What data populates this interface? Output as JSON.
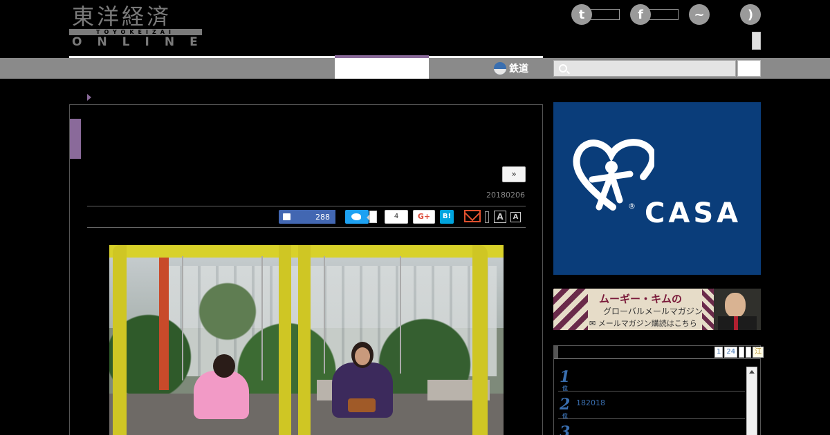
{
  "header": {
    "logo_kanji": "東洋経済",
    "logo_romaji": "TOYOKEIZAI",
    "logo_online": "ONLINE"
  },
  "nav": {
    "rail_label": "鉄道",
    "search_placeholder": ""
  },
  "article": {
    "next_label": "»",
    "date": "20180206",
    "share": {
      "facebook_count": "288",
      "hatena_count": "4",
      "gplus_label": "G+",
      "hatena_label": "B!",
      "font_large": "A",
      "font_small": "A"
    }
  },
  "sidebar": {
    "ad_casa": {
      "brand": "CASA",
      "reg": "®"
    },
    "ad_mag": {
      "title": "ムーギー・キムの",
      "subtitle": "グローバルメールマガジン",
      "cta": "メールマガジン購読はこちら"
    },
    "ranking": {
      "pages": [
        "1",
        "24",
        "",
        "",
        "江"
      ],
      "items": [
        {
          "rank": "1",
          "unit": "位",
          "text": ""
        },
        {
          "rank": "2",
          "unit": "位",
          "text": "182018"
        },
        {
          "rank": "3",
          "unit": "",
          "text": ""
        }
      ]
    }
  },
  "colors": {
    "accent_purple": "#8a6a9a",
    "nav_gray": "#8a8a8a",
    "casa_blue": "#0a3d7a",
    "link_blue": "#3a6fb0"
  }
}
